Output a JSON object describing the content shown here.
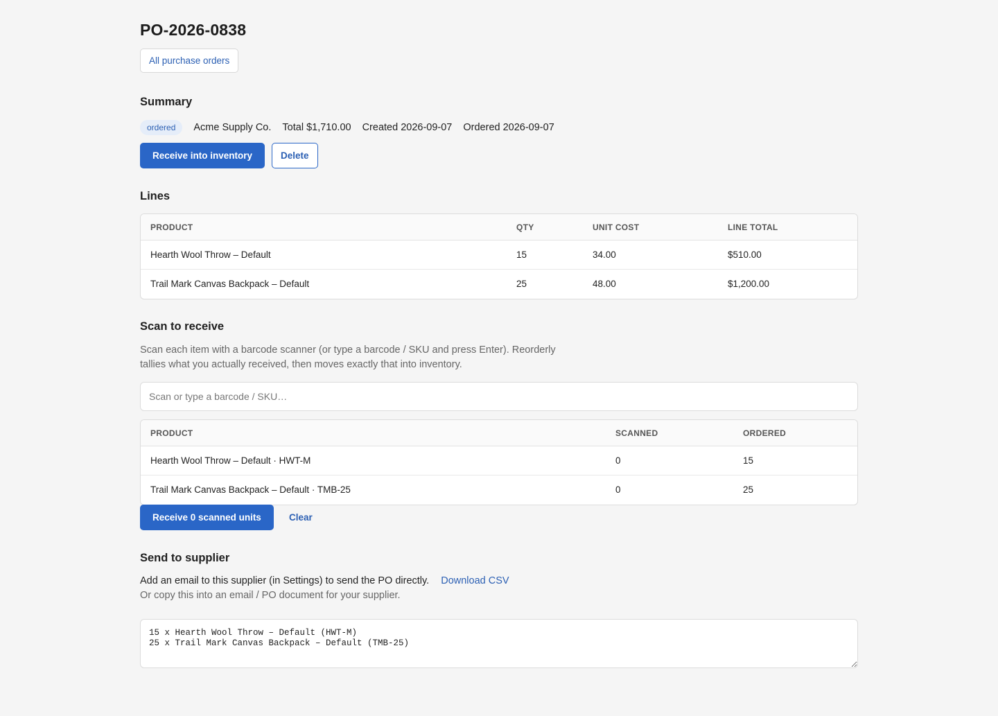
{
  "header": {
    "po_number": "PO-2026-0838",
    "back_label": "All purchase orders"
  },
  "summary": {
    "title": "Summary",
    "status": "ordered",
    "supplier": "Acme Supply Co.",
    "total": "Total $1,710.00",
    "created": "Created 2026-09-07",
    "ordered": "Ordered 2026-09-07",
    "receive_label": "Receive into inventory",
    "delete_label": "Delete"
  },
  "lines": {
    "title": "Lines",
    "columns": [
      "PRODUCT",
      "QTY",
      "UNIT COST",
      "LINE TOTAL"
    ],
    "rows": [
      {
        "product": "Hearth Wool Throw – Default",
        "qty": "15",
        "unit_cost": "34.00",
        "line_total": "$510.00"
      },
      {
        "product": "Trail Mark Canvas Backpack – Default",
        "qty": "25",
        "unit_cost": "48.00",
        "line_total": "$1,200.00"
      }
    ]
  },
  "scan": {
    "title": "Scan to receive",
    "help": "Scan each item with a barcode scanner (or type a barcode / SKU and press Enter). Reorderly tallies what you actually received, then moves exactly that into inventory.",
    "placeholder": "Scan or type a barcode / SKU…",
    "columns": [
      "PRODUCT",
      "SCANNED",
      "ORDERED"
    ],
    "rows": [
      {
        "product": "Hearth Wool Throw – Default · HWT-M",
        "scanned": "0",
        "ordered": "15"
      },
      {
        "product": "Trail Mark Canvas Backpack – Default · TMB-25",
        "scanned": "0",
        "ordered": "25"
      }
    ],
    "receive_label": "Receive 0 scanned units",
    "clear_label": "Clear"
  },
  "supplier": {
    "title": "Send to supplier",
    "note": "Add an email to this supplier (in Settings) to send the PO directly.",
    "download_label": "Download CSV",
    "sub_note": "Or copy this into an email / PO document for your supplier.",
    "po_text": "15 x Hearth Wool Throw – Default (HWT-M)\n25 x Trail Mark Canvas Backpack – Default (TMB-25)"
  },
  "colors": {
    "accent": "#2a66c7",
    "background": "#f5f5f5",
    "badge_bg": "#e5edf9"
  }
}
